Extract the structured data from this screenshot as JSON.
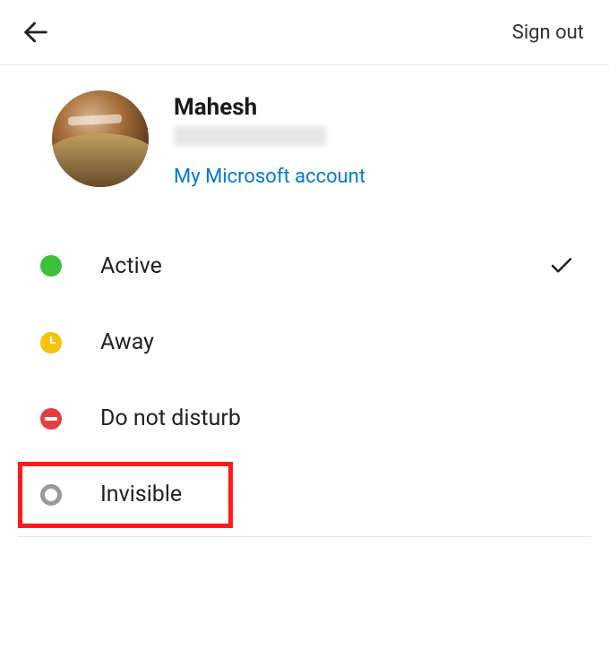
{
  "header": {
    "signout_label": "Sign out"
  },
  "profile": {
    "name": "Mahesh",
    "account_link": "My Microsoft account"
  },
  "statuses": {
    "active": {
      "label": "Active",
      "selected": true
    },
    "away": {
      "label": "Away",
      "selected": false
    },
    "dnd": {
      "label": "Do not disturb",
      "selected": false
    },
    "invisible": {
      "label": "Invisible",
      "selected": false,
      "highlighted": true
    }
  }
}
